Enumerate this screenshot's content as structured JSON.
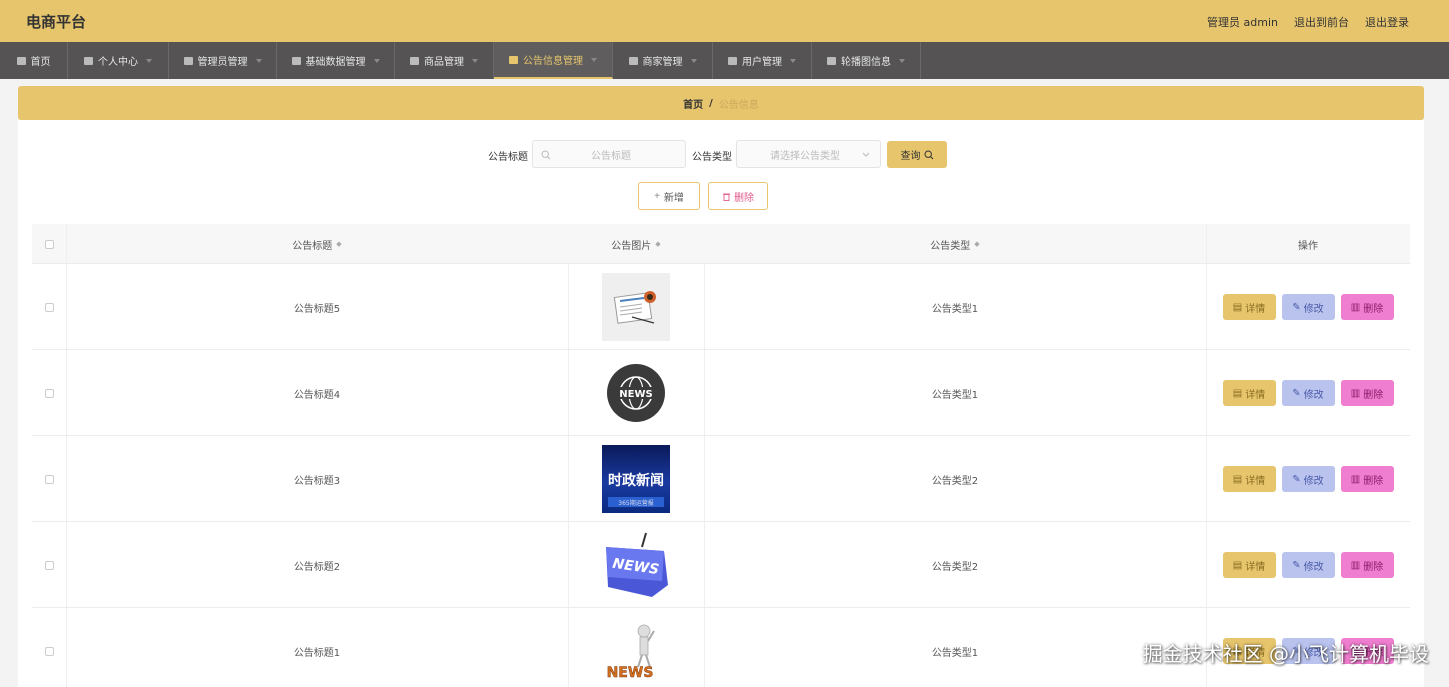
{
  "header": {
    "title": "电商平台",
    "links": [
      "管理员 admin",
      "退出到前台",
      "退出登录"
    ]
  },
  "nav": {
    "items": [
      {
        "label": "首页",
        "icon": "home-icon",
        "active": false,
        "caret": false
      },
      {
        "label": "个人中心",
        "icon": "user-icon",
        "active": false,
        "caret": true
      },
      {
        "label": "管理员管理",
        "icon": "clock-icon",
        "active": false,
        "caret": true
      },
      {
        "label": "基础数据管理",
        "icon": "list-icon",
        "active": false,
        "caret": true
      },
      {
        "label": "商品管理",
        "icon": "thumb-icon",
        "active": false,
        "caret": true
      },
      {
        "label": "公告信息管理",
        "icon": "flag-icon",
        "active": true,
        "caret": true
      },
      {
        "label": "商家管理",
        "icon": "phone-icon",
        "active": false,
        "caret": true
      },
      {
        "label": "用户管理",
        "icon": "group-icon",
        "active": false,
        "caret": true
      },
      {
        "label": "轮播图信息",
        "icon": "pin-icon",
        "active": false,
        "caret": true
      }
    ]
  },
  "breadcrumb": {
    "home": "首页",
    "separator": "/",
    "current": "公告信息"
  },
  "search": {
    "title_label": "公告标题",
    "title_placeholder": "公告标题",
    "type_label": "公告类型",
    "type_placeholder": "请选择公告类型",
    "query_label": "查询"
  },
  "actions": {
    "add_label": "新增",
    "delete_label": "删除"
  },
  "table": {
    "headers": {
      "title": "公告标题",
      "image": "公告图片",
      "type": "公告类型",
      "ops": "操作"
    },
    "rows": [
      {
        "title": "公告标题5",
        "image": "newspaper-image",
        "type": "公告类型1"
      },
      {
        "title": "公告标题4",
        "image": "news-globe-image",
        "type": "公告类型1"
      },
      {
        "title": "公告标题3",
        "image": "shizheng-news-image",
        "type": "公告类型2"
      },
      {
        "title": "公告标题2",
        "image": "news-sign-image",
        "type": "公告类型2"
      },
      {
        "title": "公告标题1",
        "image": "news-figure-image",
        "type": "公告类型1"
      }
    ],
    "op_labels": {
      "detail": "详情",
      "edit": "修改",
      "delete": "删除"
    }
  },
  "image_texts": {
    "globe": "NEWS",
    "shizheng": "时政新闻",
    "shizheng_sub": "365期运营报",
    "sign": "NEWS",
    "figure": "NEWS"
  },
  "watermark": "掘金技术社区 @小飞计算机毕设",
  "colors": {
    "accent": "#e6c56d",
    "nav_bg": "#555354",
    "edit": "#b9c3ee",
    "delete": "#f07ed0"
  }
}
